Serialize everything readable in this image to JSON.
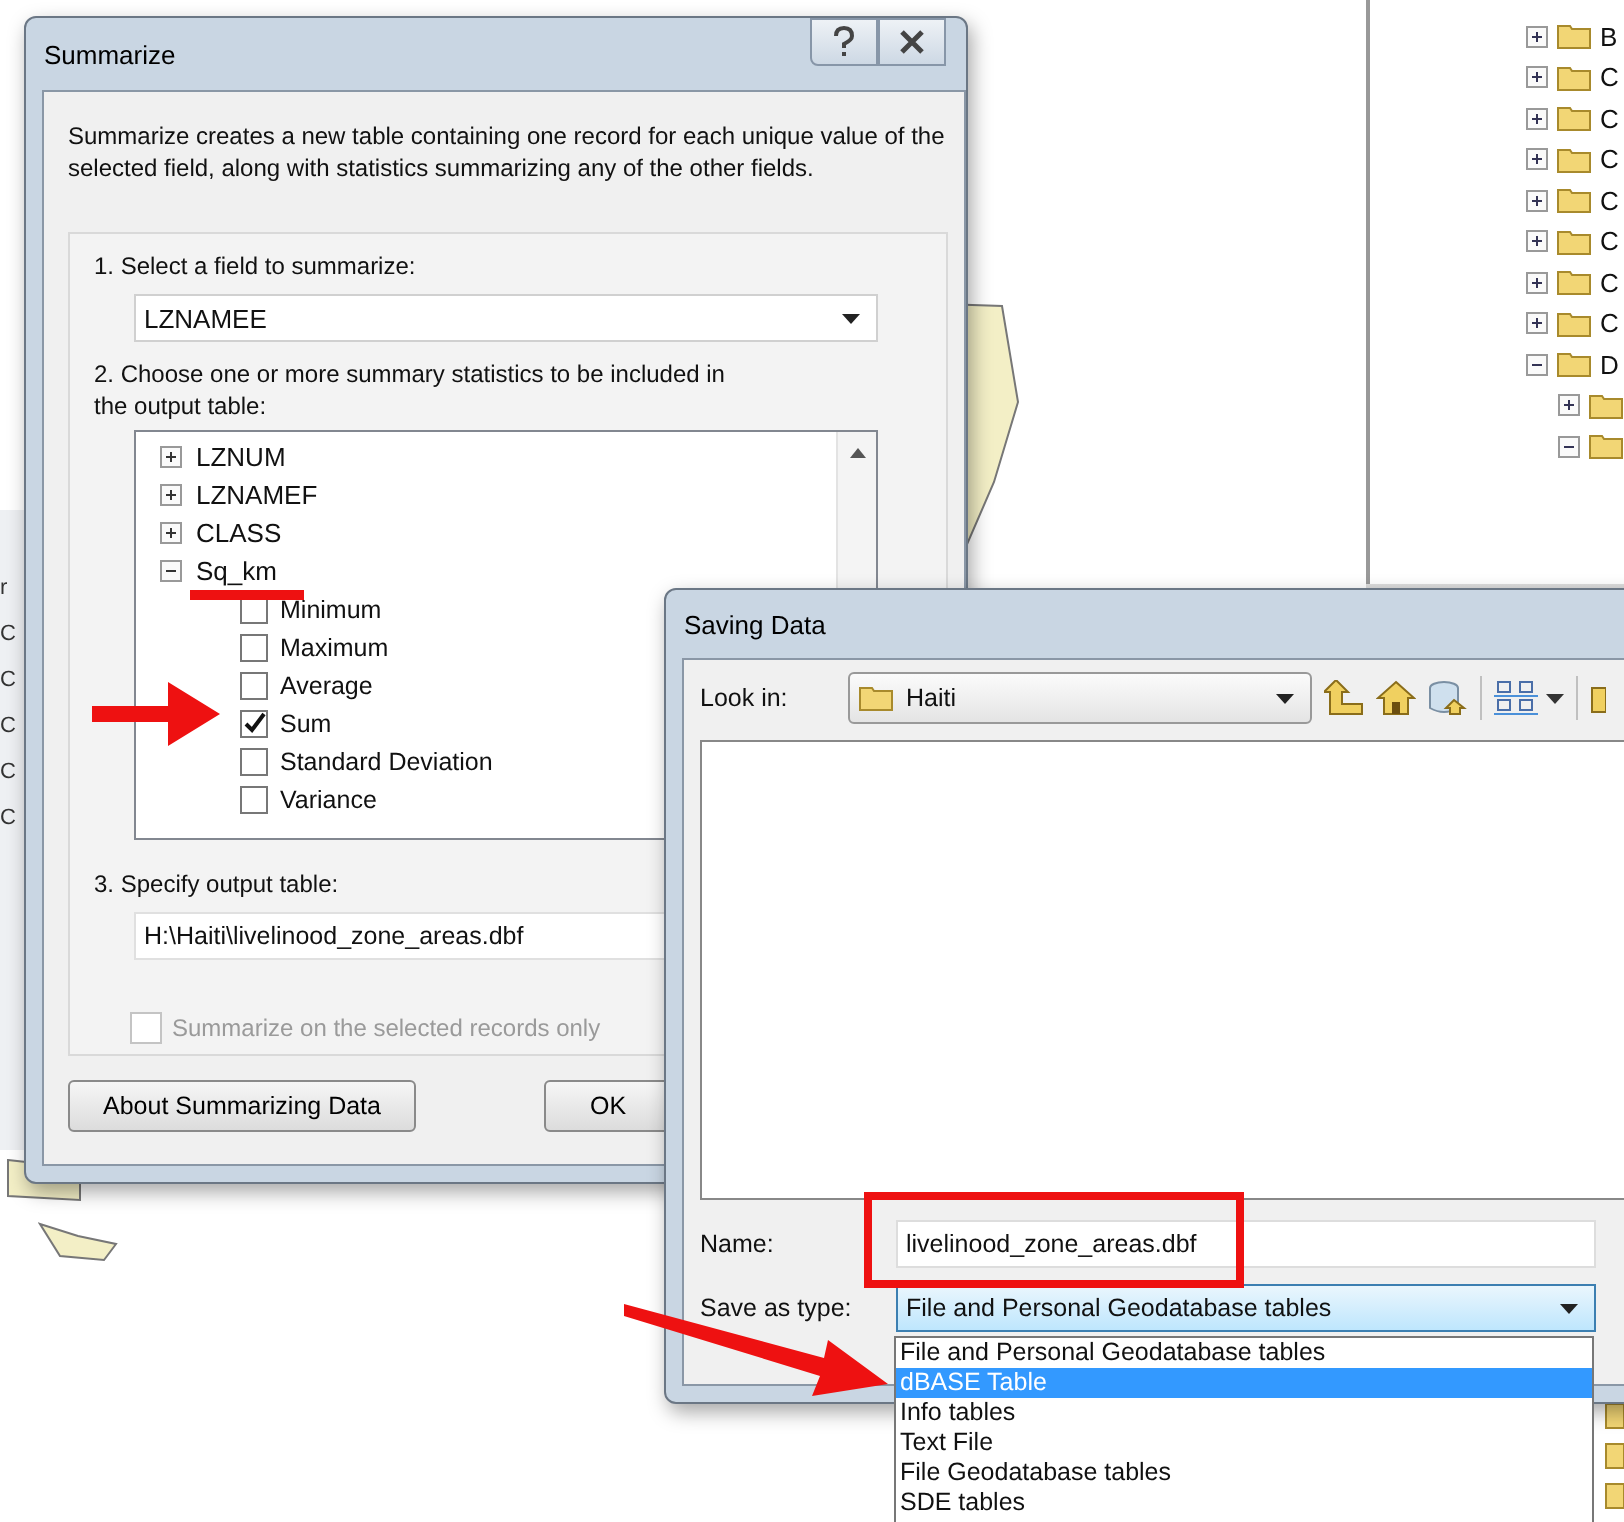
{
  "summarize_window": {
    "title": "Summarize",
    "description": "Summarize creates a new table containing one record for each unique value of the selected field, along with statistics summarizing any of the other fields.",
    "step1_label": "1.  Select a field to summarize:",
    "field_dropdown": {
      "value": "LZNAMEE"
    },
    "step2_label": "2.  Choose one or more summary statistics to be included in the output table:",
    "fields": [
      {
        "label": "LZNUM",
        "expanded": false
      },
      {
        "label": "LZNAMEF",
        "expanded": false
      },
      {
        "label": "CLASS",
        "expanded": false
      },
      {
        "label": "Sq_km",
        "expanded": true,
        "children": [
          {
            "label": "Minimum",
            "checked": false
          },
          {
            "label": "Maximum",
            "checked": false
          },
          {
            "label": "Average",
            "checked": false
          },
          {
            "label": "Sum",
            "checked": true
          },
          {
            "label": "Standard Deviation",
            "checked": false
          },
          {
            "label": "Variance",
            "checked": false
          }
        ]
      }
    ],
    "step3_label": "3.  Specify output table:",
    "output_table": {
      "value": "H:\\Haiti\\livelinood_zone_areas.dbf"
    },
    "selected_only": {
      "label": "Summarize on the selected records only",
      "checked": false,
      "disabled": true
    },
    "buttons": [
      "About Summarizing Data",
      "OK"
    ]
  },
  "saving_window": {
    "title": "Saving Data",
    "look_in_label": "Look in:",
    "look_in": {
      "value": "Haiti"
    },
    "name_label": "Name:",
    "name": {
      "value": "livelinood_zone_areas.dbf"
    },
    "type_label": "Save as type:",
    "type_select": {
      "value": "File and Personal Geodatabase tables"
    },
    "type_options": [
      {
        "label": "File and Personal Geodatabase tables",
        "selected": false
      },
      {
        "label": "dBASE Table",
        "selected": true
      },
      {
        "label": "Info tables",
        "selected": false
      },
      {
        "label": "Text File",
        "selected": false
      },
      {
        "label": "File Geodatabase tables",
        "selected": false
      },
      {
        "label": "SDE tables",
        "selected": false
      }
    ]
  },
  "tree": [
    {
      "label": "B",
      "expanded": false
    },
    {
      "label": "C",
      "expanded": false
    },
    {
      "label": "C",
      "expanded": false
    },
    {
      "label": "C",
      "expanded": false
    },
    {
      "label": "C",
      "expanded": false
    },
    {
      "label": "C",
      "expanded": false
    },
    {
      "label": "C",
      "expanded": false
    },
    {
      "label": "C",
      "expanded": false
    },
    {
      "label": "D",
      "expanded": true,
      "children": [
        {
          "expanded": false
        },
        {
          "expanded": true
        }
      ]
    }
  ],
  "left_fragments": [
    "r",
    "C",
    "C",
    "C",
    "C",
    "C"
  ]
}
